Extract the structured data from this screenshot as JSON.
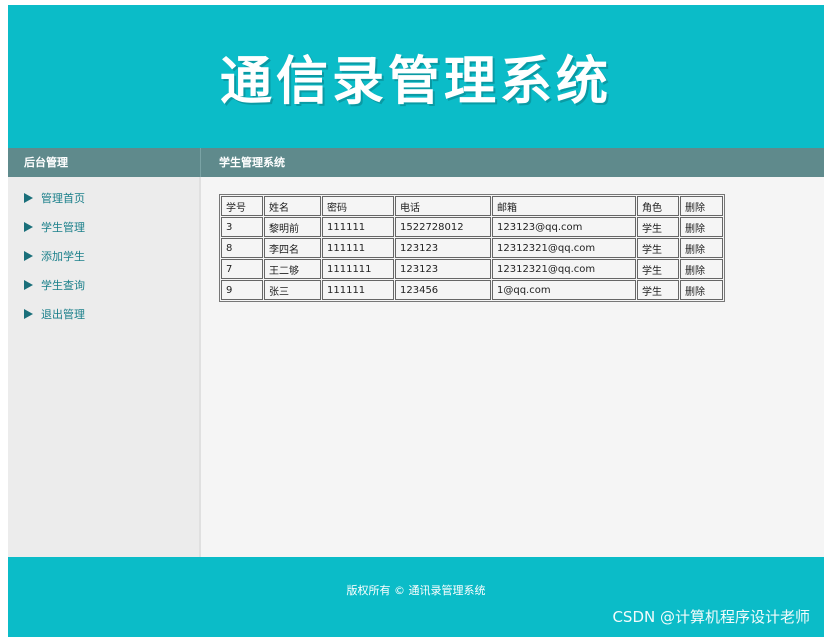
{
  "header": {
    "title": "通信录管理系统"
  },
  "sidebar": {
    "title": "后台管理",
    "items": [
      {
        "label": "管理首页"
      },
      {
        "label": "学生管理"
      },
      {
        "label": "添加学生"
      },
      {
        "label": "学生查询"
      },
      {
        "label": "退出管理"
      }
    ]
  },
  "main": {
    "title": "学生管理系统",
    "table": {
      "headers": [
        "学号",
        "姓名",
        "密码",
        "电话",
        "邮箱",
        "角色",
        "删除"
      ],
      "rows": [
        [
          "3",
          "黎明前",
          "111111",
          "1522728012",
          "123123@qq.com",
          "学生",
          "删除"
        ],
        [
          "8",
          "李四名",
          "111111",
          "123123",
          "12312321@qq.com",
          "学生",
          "删除"
        ],
        [
          "7",
          "王二够",
          "1111111",
          "123123",
          "12312321@qq.com",
          "学生",
          "删除"
        ],
        [
          "9",
          "张三",
          "111111",
          "123456",
          "1@qq.com",
          "学生",
          "删除"
        ]
      ]
    }
  },
  "footer": {
    "text": "版权所有 © 通讯录管理系统"
  },
  "watermark": "CSDN @计算机程序设计老师",
  "colors": {
    "header": "#0bbcc8",
    "bar": "#5f8a8c",
    "link": "#1a7f8a",
    "delete": "#d0103a"
  }
}
